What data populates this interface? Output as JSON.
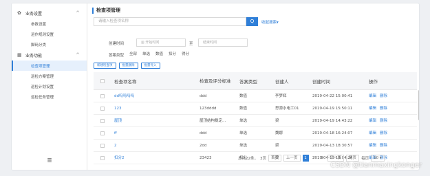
{
  "sidebar": {
    "groups": [
      {
        "label": "业务设置",
        "items": [
          "参数设置",
          "运作规则设置",
          "脚码分类"
        ]
      },
      {
        "label": "业务功能",
        "items": [
          "检查项管理",
          "巡检方案管理",
          "巡检计划设置",
          "巡检任务管理"
        ]
      }
    ],
    "collapse_icon": "≣"
  },
  "main": {
    "title": "检查项管理",
    "search_placeholder": "请输入检查项名称",
    "search_icon": "Q",
    "advanced": "收起搜索▾",
    "filter": {
      "time_label": "创建时间",
      "start_placeholder": "开始时间",
      "to_label": "至",
      "end_placeholder": "结束时间",
      "type_label": "答案类型",
      "types": [
        "全部",
        "单选",
        "数值",
        "扣分",
        "得分"
      ]
    },
    "buttons": [
      "新建检查项",
      "批量删除",
      "批量导入"
    ],
    "table": {
      "headers": [
        "检查项名称",
        "检查及评分标准",
        "答案类型",
        "创建人",
        "创建时间",
        "操作"
      ],
      "rows": [
        {
          "name": "dd吗吗吗吗",
          "standard": "ddd",
          "type": "数值",
          "creator": "李梦辉",
          "time": "2019-04-22 15:00:41",
          "edit": "编辑",
          "del": "删除"
        },
        {
          "name": "123",
          "standard": "123dddd",
          "type": "数值",
          "creator": "思源水电工01",
          "time": "2019-04-19 15:50:11",
          "edit": "编辑",
          "del": "删除"
        },
        {
          "name": "屋顶",
          "standard": "屋顶结构稳定...",
          "type": "单选",
          "creator": "梁",
          "time": "2019-04-19 14:43:22",
          "edit": "编辑",
          "del": "删除"
        },
        {
          "name": "ff",
          "standard": "ddd",
          "type": "单选",
          "creator": "魏娜",
          "time": "2019-04-18 16:24:07",
          "edit": "编辑",
          "del": "删除"
        },
        {
          "name": "2",
          "standard": "2dd",
          "type": "单选",
          "creator": "梁",
          "time": "2019-04-13 18:30:57",
          "edit": "编辑",
          "del": "删除"
        },
        {
          "name": "扣分2",
          "standard": "23423",
          "type": "扣分",
          "creator": "梁",
          "time": "2019-04-13 18:04:24",
          "edit": "编辑",
          "del": "删除"
        }
      ]
    },
    "pager": {
      "total": "总共22条，",
      "pages": "3页",
      "first": "首页",
      "prev": "上一页",
      "nums": [
        "1",
        "2",
        "3"
      ],
      "next": "下一页",
      "last": "尾页",
      "size_label": "每页",
      "size": "10 ▾"
    }
  },
  "watermark": "CSDN @tianmaxingkonger"
}
